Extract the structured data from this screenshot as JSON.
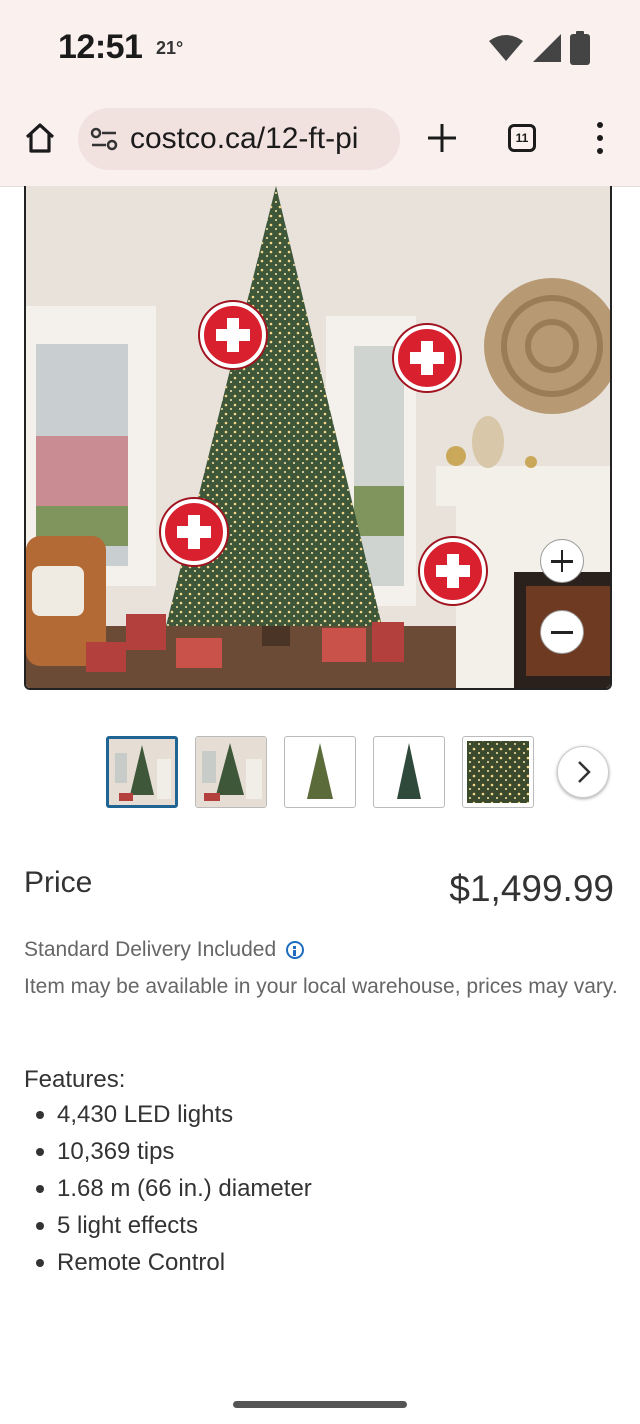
{
  "status_bar": {
    "time": "12:51",
    "temperature": "21°",
    "icons": [
      "wifi-icon",
      "cellular-signal-icon",
      "battery-icon"
    ]
  },
  "browser": {
    "home_icon": "home-icon",
    "url": "costco.ca/12-ft-pi",
    "site_settings_icon": "tune-icon",
    "new_tab_icon": "plus-icon",
    "tab_count": "11",
    "menu_icon": "more-vert-icon"
  },
  "product": {
    "image": {
      "hotspot_count": 4,
      "zoom_in_icon": "plus-icon",
      "zoom_out_icon": "minus-icon"
    },
    "thumbnails": {
      "count": 5,
      "selected_index": 0,
      "next_icon": "chevron-right-icon"
    },
    "price_label": "Price",
    "price": "$1,499.99",
    "delivery": "Standard Delivery Included",
    "availability": "Item may be available in your local warehouse, prices may vary.",
    "features_title": "Features:",
    "features": [
      "4,430 LED lights",
      "10,369 tips",
      "1.68 m (66 in.) diameter",
      "5 light effects",
      "Remote Control"
    ]
  },
  "colors": {
    "chrome_bg": "#faf1ee",
    "omnibox_bg": "#f1e1df",
    "hotspot_red": "#d8202f",
    "thumb_selected": "#1f6493",
    "info_blue": "#1f6cc0"
  }
}
